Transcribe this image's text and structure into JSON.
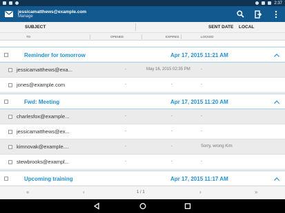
{
  "statusbar": {
    "time": "2:37"
  },
  "account": {
    "email": "jessicamatthews@example.com",
    "subtitle": "Manage"
  },
  "columns": {
    "subject": "SUBJECT",
    "sent_date": "SENT DATE",
    "local": "LOCAL",
    "to": "TO",
    "opened": "OPENED",
    "expires": "EXPIRES",
    "locked": "LOCKED"
  },
  "groups": [
    {
      "title": "Reminder for tomorrow",
      "date": "Apr 17, 2015 11:21 AM",
      "recipients": [
        {
          "to": "jessicamatthews@exa...",
          "opened": "-",
          "expires": "May 16, 2015 02:35 PM",
          "locked": "-"
        },
        {
          "to": "jones@example.com",
          "opened": "-",
          "expires": "-",
          "locked": "-"
        }
      ]
    },
    {
      "title": "Fwd: Meeting",
      "date": "Apr 17, 2015 11:20 AM",
      "recipients": [
        {
          "to": "charlesfox@example...",
          "opened": "-",
          "expires": "-",
          "locked": "-"
        },
        {
          "to": "jessicamatthews@ex...",
          "opened": "-",
          "expires": "-",
          "locked": "-"
        },
        {
          "to": "kimnovak@example....",
          "opened": "-",
          "expires": "-",
          "locked": "Sorry, wrong Kim"
        },
        {
          "to": "stewbrooks@exampl...",
          "opened": "-",
          "expires": "-",
          "locked": "-"
        }
      ]
    },
    {
      "title": "Upcoming training",
      "date": "Apr 17, 2015 11:17 AM",
      "recipients": []
    }
  ],
  "pager": {
    "first": "«",
    "prev": "‹",
    "page": "1 / 1",
    "next": "›",
    "last": "»"
  },
  "colors": {
    "appbar": "#12598f",
    "statusbar": "#0f3350",
    "accent": "#2490d0"
  }
}
